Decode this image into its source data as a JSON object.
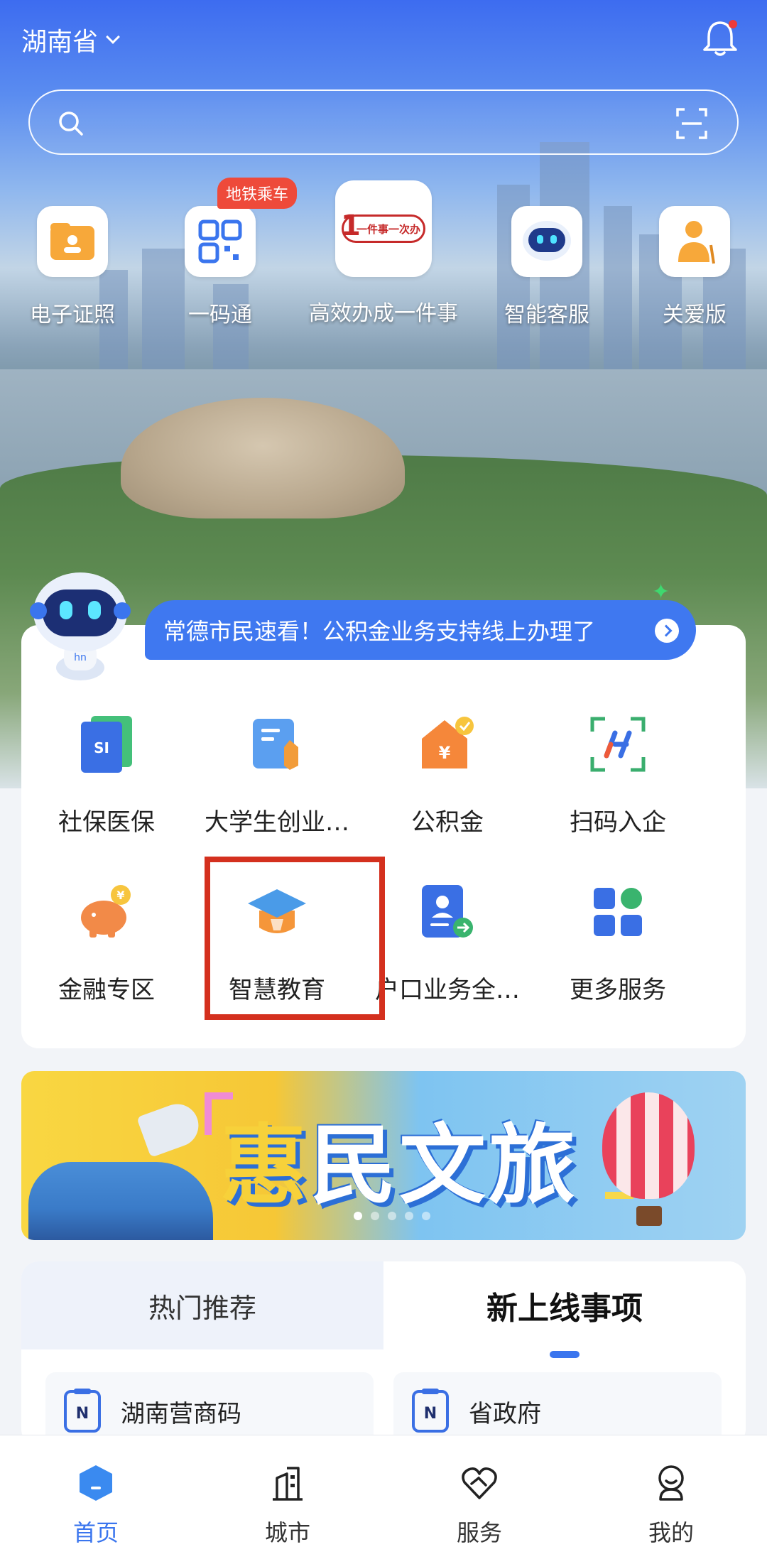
{
  "header": {
    "province": "湖南省"
  },
  "search": {
    "placeholder": ""
  },
  "quick_entries": [
    {
      "label": "电子证照",
      "icon": "folder-icon"
    },
    {
      "label": "一码通",
      "icon": "qr-code-icon",
      "badge": "地铁乘车"
    },
    {
      "label": "高效办成一件事",
      "icon": "one-thing-logo-icon",
      "logo_text": "一件事一次办"
    },
    {
      "label": "智能客服",
      "icon": "robot-icon"
    },
    {
      "label": "关爱版",
      "icon": "elder-care-icon"
    }
  ],
  "assistant": {
    "message": "常德市民速看！公积金业务支持线上办理了"
  },
  "services": [
    {
      "label": "社保医保",
      "icon": "social-security-icon",
      "icon_text": "SI"
    },
    {
      "label": "大学生创业…",
      "icon": "student-startup-icon"
    },
    {
      "label": "公积金",
      "icon": "housing-fund-icon",
      "icon_text": "¥"
    },
    {
      "label": "扫码入企",
      "icon": "scan-enterprise-icon"
    },
    {
      "label": "金融专区",
      "icon": "piggy-bank-icon",
      "icon_text": "¥"
    },
    {
      "label": "智慧教育",
      "icon": "graduation-cap-icon"
    },
    {
      "label": "户口业务全…",
      "icon": "household-registration-icon"
    },
    {
      "label": "更多服务",
      "icon": "more-services-icon"
    }
  ],
  "banner": {
    "title_first": "惠",
    "title_rest": "民文旅",
    "slides": 5,
    "active_slide": 1
  },
  "recommend": {
    "tabs": [
      {
        "label": "热门推荐",
        "active": false
      },
      {
        "label": "新上线事项",
        "active": true
      }
    ],
    "items": [
      {
        "label": "湖南营商码",
        "icon": "document-n-icon"
      },
      {
        "label": "省政府",
        "icon": "document-n-icon"
      }
    ]
  },
  "bottom_nav": [
    {
      "label": "首页",
      "icon": "home-icon",
      "active": true
    },
    {
      "label": "城市",
      "icon": "city-icon",
      "active": false
    },
    {
      "label": "服务",
      "icon": "service-heart-icon",
      "active": false
    },
    {
      "label": "我的",
      "icon": "profile-icon",
      "active": false
    }
  ],
  "colors": {
    "accent": "#3a75ee",
    "highlight_box": "#d4301e",
    "badge": "#ee4a3a",
    "bubble": "#3f78f0"
  }
}
